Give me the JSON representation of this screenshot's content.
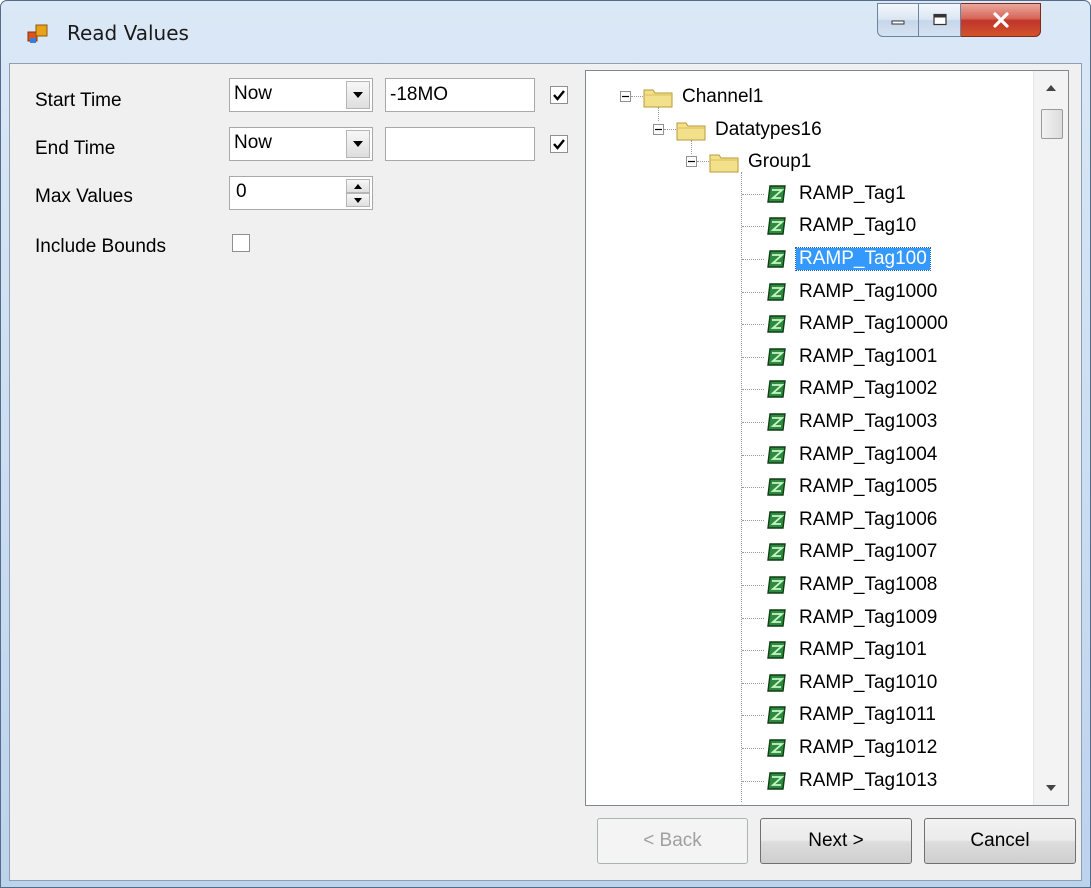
{
  "window": {
    "title": "Read Values",
    "accent": "#3399ff"
  },
  "form": {
    "start_time_label": "Start Time",
    "start_time_combo": "Now",
    "start_time_offset": "-18MO",
    "start_time_checked": true,
    "end_time_label": "End Time",
    "end_time_combo": "Now",
    "end_time_offset": "",
    "end_time_checked": true,
    "max_values_label": "Max Values",
    "max_values": "0",
    "include_bounds_label": "Include Bounds",
    "include_bounds_checked": false
  },
  "tree": {
    "channel": "Channel1",
    "device": "Datatypes16",
    "group": "Group1",
    "selected_tag": "RAMP_Tag100",
    "tags": [
      "RAMP_Tag1",
      "RAMP_Tag10",
      "RAMP_Tag100",
      "RAMP_Tag1000",
      "RAMP_Tag10000",
      "RAMP_Tag1001",
      "RAMP_Tag1002",
      "RAMP_Tag1003",
      "RAMP_Tag1004",
      "RAMP_Tag1005",
      "RAMP_Tag1006",
      "RAMP_Tag1007",
      "RAMP_Tag1008",
      "RAMP_Tag1009",
      "RAMP_Tag101",
      "RAMP_Tag1010",
      "RAMP_Tag1011",
      "RAMP_Tag1012",
      "RAMP_Tag1013"
    ],
    "icons": {
      "folder": "folder-icon",
      "tag": "tag-icon",
      "expander": "collapse-icon"
    }
  },
  "buttons": {
    "back": "< Back",
    "next": "Next >",
    "cancel": "Cancel"
  }
}
